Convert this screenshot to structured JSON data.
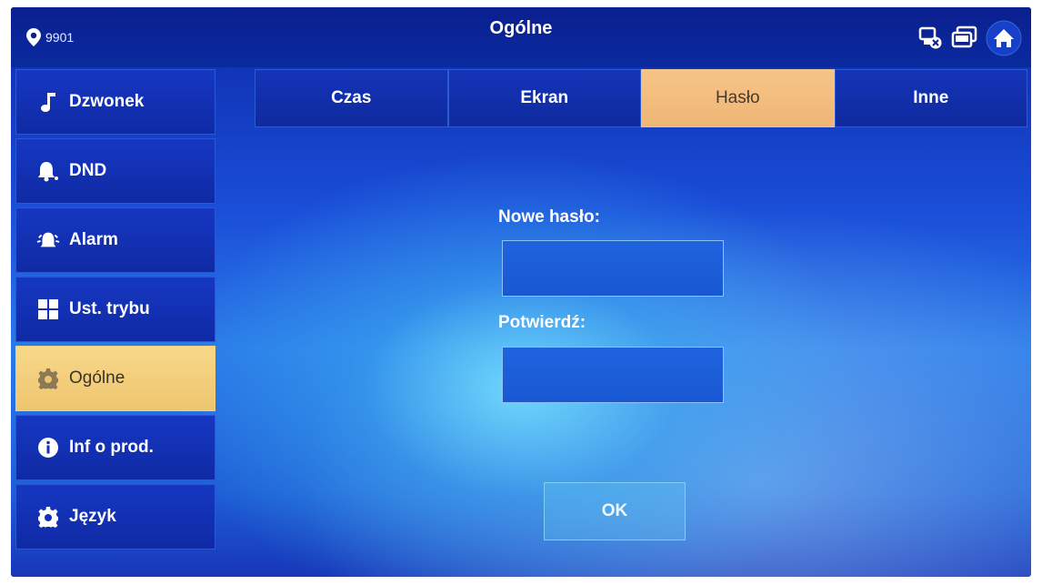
{
  "header": {
    "location": "9901",
    "title": "Ogólne",
    "icons": [
      "network-status-icon",
      "monitor-icon",
      "home-icon"
    ]
  },
  "sidebar": {
    "items": [
      {
        "label": "Dzwonek",
        "icon": "music-note-icon",
        "active": false
      },
      {
        "label": "DND",
        "icon": "bell-mute-icon",
        "active": false
      },
      {
        "label": "Alarm",
        "icon": "alarm-icon",
        "active": false
      },
      {
        "label": "Ust. trybu",
        "icon": "grid-icon",
        "active": false
      },
      {
        "label": "Ogólne",
        "icon": "gear-icon",
        "active": true
      },
      {
        "label": "Inf o prod.",
        "icon": "info-icon",
        "active": false
      },
      {
        "label": "Język",
        "icon": "gear-icon",
        "active": false
      }
    ]
  },
  "tabs": [
    {
      "label": "Czas",
      "active": false
    },
    {
      "label": "Ekran",
      "active": false
    },
    {
      "label": "Hasło",
      "active": true
    },
    {
      "label": "Inne",
      "active": false
    }
  ],
  "form": {
    "new_password_label": "Nowe hasło:",
    "new_password_value": "",
    "confirm_label": "Potwierdź:",
    "confirm_value": "",
    "ok_label": "OK"
  },
  "colors": {
    "active_sidebar": "#eec56f",
    "active_tab": "#efb676",
    "header": "#0b1f8e"
  }
}
